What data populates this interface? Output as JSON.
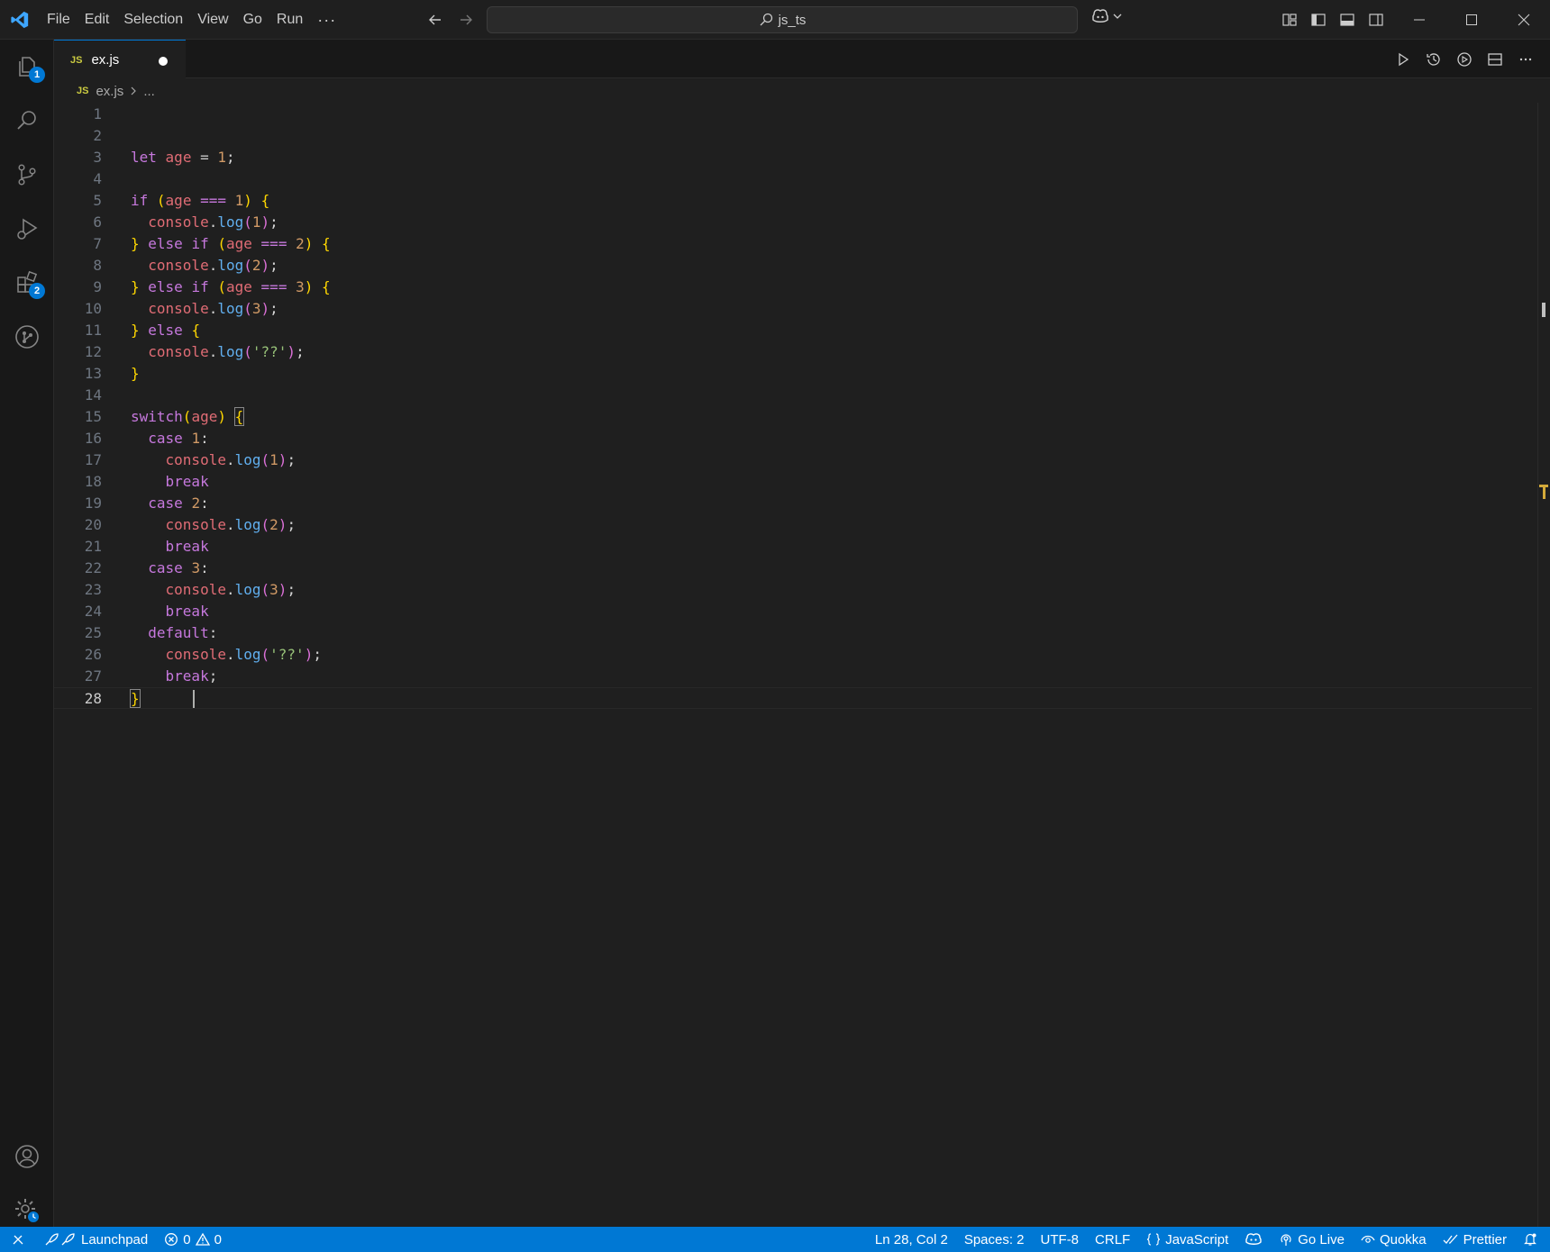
{
  "window": {
    "menus": [
      "File",
      "Edit",
      "Selection",
      "View",
      "Go",
      "Run"
    ],
    "more": "···",
    "search_label": "js_ts"
  },
  "activity": {
    "explorer_badge": "1",
    "extensions_badge": "2"
  },
  "tab": {
    "icon": "JS",
    "label": "ex.js"
  },
  "breadcrumb": {
    "icon": "JS",
    "file": "ex.js",
    "more": "..."
  },
  "editor": {
    "line_numbers": [
      "1",
      "2",
      "3",
      "4",
      "5",
      "6",
      "7",
      "8",
      "9",
      "10",
      "11",
      "12",
      "13",
      "14",
      "15",
      "16",
      "17",
      "18",
      "19",
      "20",
      "21",
      "22",
      "23",
      "24",
      "25",
      "26",
      "27",
      "28"
    ],
    "current_line": 28,
    "code_lines": [
      "",
      "",
      "let age = 1;",
      "",
      "if (age === 1) {",
      "  console.log(1);",
      "} else if (age === 2) {",
      "  console.log(2);",
      "} else if (age === 3) {",
      "  console.log(3);",
      "} else {",
      "  console.log('??');",
      "}",
      "",
      "switch(age) {",
      "  case 1:",
      "    console.log(1);",
      "    break",
      "  case 2:",
      "    console.log(2);",
      "    break",
      "  case 3:",
      "    console.log(3);",
      "    break",
      "  default:",
      "    console.log('??');",
      "    break;",
      "}"
    ]
  },
  "status": {
    "launchpad": "Launchpad",
    "errors": "0",
    "warnings": "0",
    "position": "Ln 28, Col 2",
    "spaces": "Spaces: 2",
    "encoding": "UTF-8",
    "eol": "CRLF",
    "language": "JavaScript",
    "go_live": "Go Live",
    "quokka": "Quokka",
    "prettier": "Prettier"
  },
  "colors": {
    "accent": "#0078d4",
    "editor_bg": "#1f1f1f",
    "keyword": "#c586c0",
    "variable": "#e06c75",
    "function": "#61afef",
    "string": "#98c379",
    "bracket": "#ffd700"
  }
}
